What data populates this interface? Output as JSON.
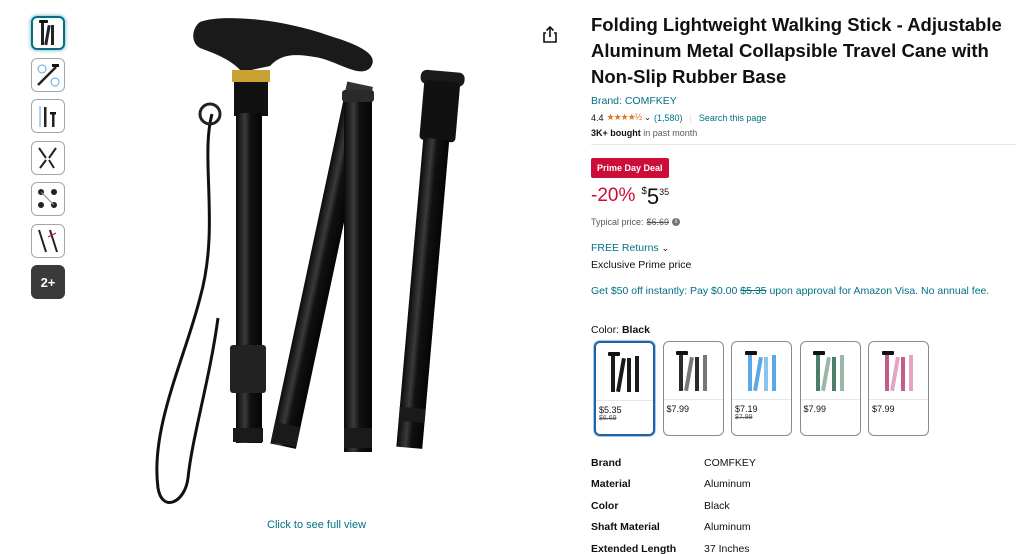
{
  "thumbnails": [
    {
      "icon": "cane-thumb-1"
    },
    {
      "icon": "cane-thumb-2"
    },
    {
      "icon": "cane-thumb-3"
    },
    {
      "icon": "cane-thumb-4"
    },
    {
      "icon": "cane-thumb-5"
    },
    {
      "icon": "cane-thumb-6"
    }
  ],
  "more_thumbs_label": "2+",
  "click_full_view": "Click to see full view",
  "product": {
    "title": "Folding Lightweight Walking Stick - Adjustable Aluminum Metal Collapsible Travel Cane with Non-Slip Rubber Base",
    "brand_link": "Brand: COMFKEY",
    "rating": "4.4",
    "stars": "★★★★½",
    "rating_count": "(1,580)",
    "search_page": "Search this page",
    "bought_bold": "3K+ bought",
    "bought_rest": " in past month",
    "deal_badge": "Prime Day Deal",
    "discount": "-20%",
    "price_symbol": "$",
    "price_whole": "5",
    "price_fraction": "35",
    "typical_label": "Typical price:",
    "typical_price": "$6.69",
    "free_returns": "FREE Returns",
    "exclusive": "Exclusive Prime price",
    "promo_part1": "Get $50 off instantly: Pay $0.00 ",
    "promo_strike": "$5.35",
    "promo_part2": " upon approval for Amazon Visa. No annual fee.",
    "color_label": "Color: ",
    "color_value": "Black"
  },
  "swatches": [
    {
      "price": "$5.35",
      "list": "$6.69",
      "color": "#1a1a1a"
    },
    {
      "price": "$7.99",
      "list": "",
      "color": "#2b2b2b"
    },
    {
      "price": "$7.19",
      "list": "$7.99",
      "color": "#5aa9e6"
    },
    {
      "price": "$7.99",
      "list": "",
      "color": "#4a7d6a"
    },
    {
      "price": "$7.99",
      "list": "",
      "color": "#c25c8a"
    }
  ],
  "specs": [
    {
      "key": "Brand",
      "value": "COMFKEY"
    },
    {
      "key": "Material",
      "value": "Aluminum"
    },
    {
      "key": "Color",
      "value": "Black"
    },
    {
      "key": "Shaft Material",
      "value": "Aluminum"
    },
    {
      "key": "Extended Length",
      "value": "37 Inches"
    }
  ],
  "colors": {
    "link": "#007185",
    "deal": "#cc0c39",
    "star": "#de7921",
    "selected": "#2162a1"
  }
}
